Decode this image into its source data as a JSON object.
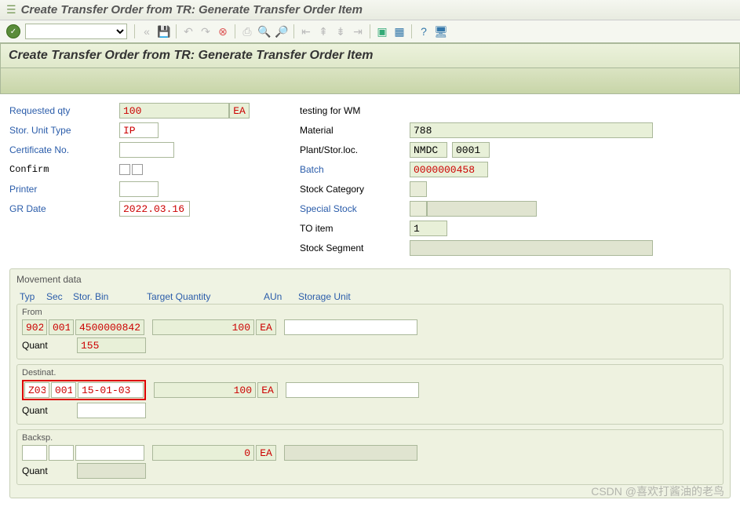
{
  "window": {
    "title": "Create Transfer Order from TR: Generate Transfer Order Item"
  },
  "header": {
    "title": "Create Transfer Order from TR: Generate Transfer Order Item"
  },
  "left": {
    "req_qty_label": "Requested qty",
    "req_qty": "100",
    "req_qty_unit": "EA",
    "sut_label": "Stor. Unit Type",
    "sut": "IP",
    "cert_label": "Certificate No.",
    "cert": "",
    "confirm_label": "Confirm",
    "printer_label": "Printer",
    "printer": "",
    "gr_label": "GR Date",
    "gr": "2022.03.16"
  },
  "right": {
    "testing": "testing for WM",
    "material_label": "Material",
    "material": "788",
    "plant_label": "Plant/Stor.loc.",
    "plant": "NMDC",
    "sloc": "0001",
    "batch_label": "Batch",
    "batch": "0000000458",
    "stockcat_label": "Stock Category",
    "stockcat": "",
    "special_label": "Special Stock",
    "special1": "",
    "special2": "",
    "toitem_label": "TO item",
    "toitem": "1",
    "stockseg_label": "Stock Segment",
    "stockseg": ""
  },
  "movement": {
    "title": "Movement data",
    "cols": {
      "typ": "Typ",
      "sec": "Sec",
      "bin": "Stor. Bin",
      "tq": "Target Quantity",
      "aun": "AUn",
      "su": "Storage Unit"
    },
    "from": {
      "title": "From",
      "typ": "902",
      "sec": "001",
      "bin": "4500000842",
      "qty": "100",
      "aun": "EA",
      "su": "",
      "quant_label": "Quant",
      "quant": "155"
    },
    "dest": {
      "title": "Destinat.",
      "typ": "Z03",
      "sec": "001",
      "bin": "15-01-03",
      "qty": "100",
      "aun": "EA",
      "su": "",
      "quant_label": "Quant",
      "quant": ""
    },
    "back": {
      "title": "Backsp.",
      "typ": "",
      "sec": "",
      "bin": "",
      "qty": "0",
      "aun": "EA",
      "su": "",
      "quant_label": "Quant",
      "quant": ""
    }
  },
  "watermark": "CSDN @喜欢打酱油的老鸟"
}
